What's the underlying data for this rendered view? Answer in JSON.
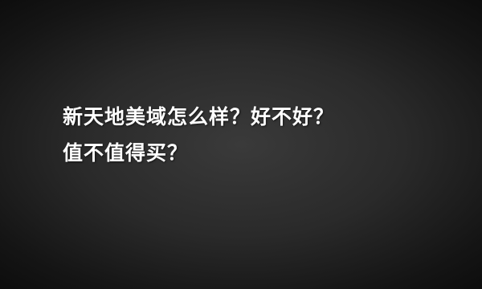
{
  "background_color": "#2e2e2e",
  "text_color": "#ffffff",
  "headline": {
    "line1": "新天地美域怎么样？好不好？",
    "line2": "值不值得买？"
  }
}
